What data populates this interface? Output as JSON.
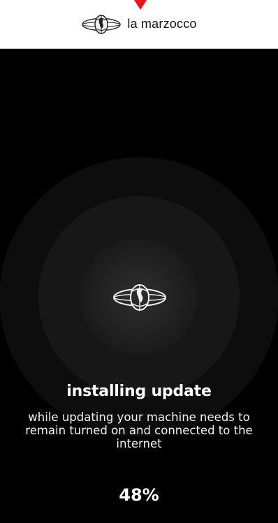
{
  "header": {
    "brand": "la marzocco",
    "logo_icon": "la-marzocco-globe-logo-icon"
  },
  "update": {
    "title": "installing update",
    "message": "while updating your machine needs to remain turned on and connected to the internet",
    "progress_label": "48%",
    "progress": 0.48
  },
  "colors": {
    "background": "#000000",
    "header_background": "#ffffff",
    "text": "#ffffff",
    "marker": "#e11b1b"
  }
}
